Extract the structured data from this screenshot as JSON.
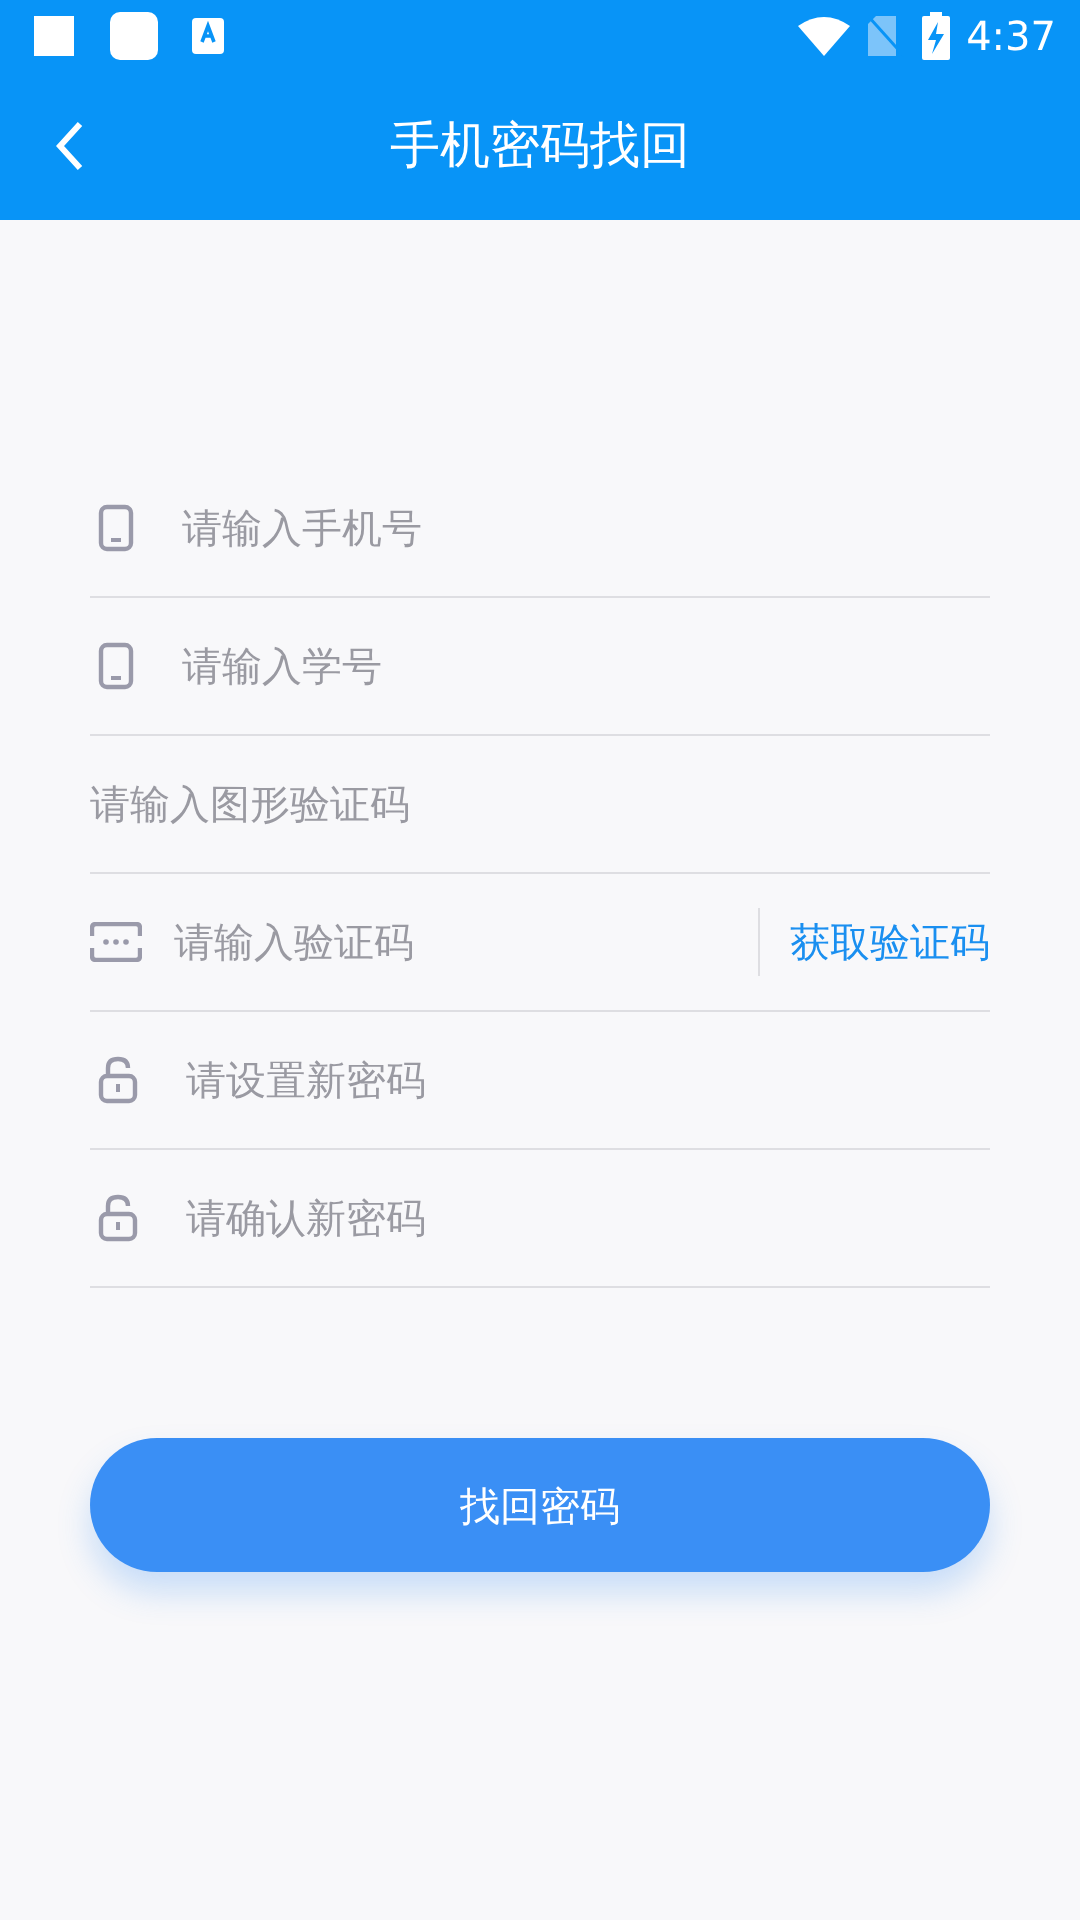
{
  "status_bar": {
    "time": "4:37"
  },
  "header": {
    "title": "手机密码找回"
  },
  "fields": [
    {
      "kind": "phone",
      "placeholder": "请输入手机号"
    },
    {
      "kind": "phone",
      "placeholder": "请输入学号"
    },
    {
      "kind": "plain",
      "placeholder": "请输入图形验证码"
    },
    {
      "kind": "code",
      "placeholder": "请输入验证码",
      "action": "获取验证码"
    },
    {
      "kind": "lock",
      "placeholder": "请设置新密码"
    },
    {
      "kind": "lock",
      "placeholder": "请确认新密码"
    }
  ],
  "submit": {
    "label": "找回密码"
  }
}
